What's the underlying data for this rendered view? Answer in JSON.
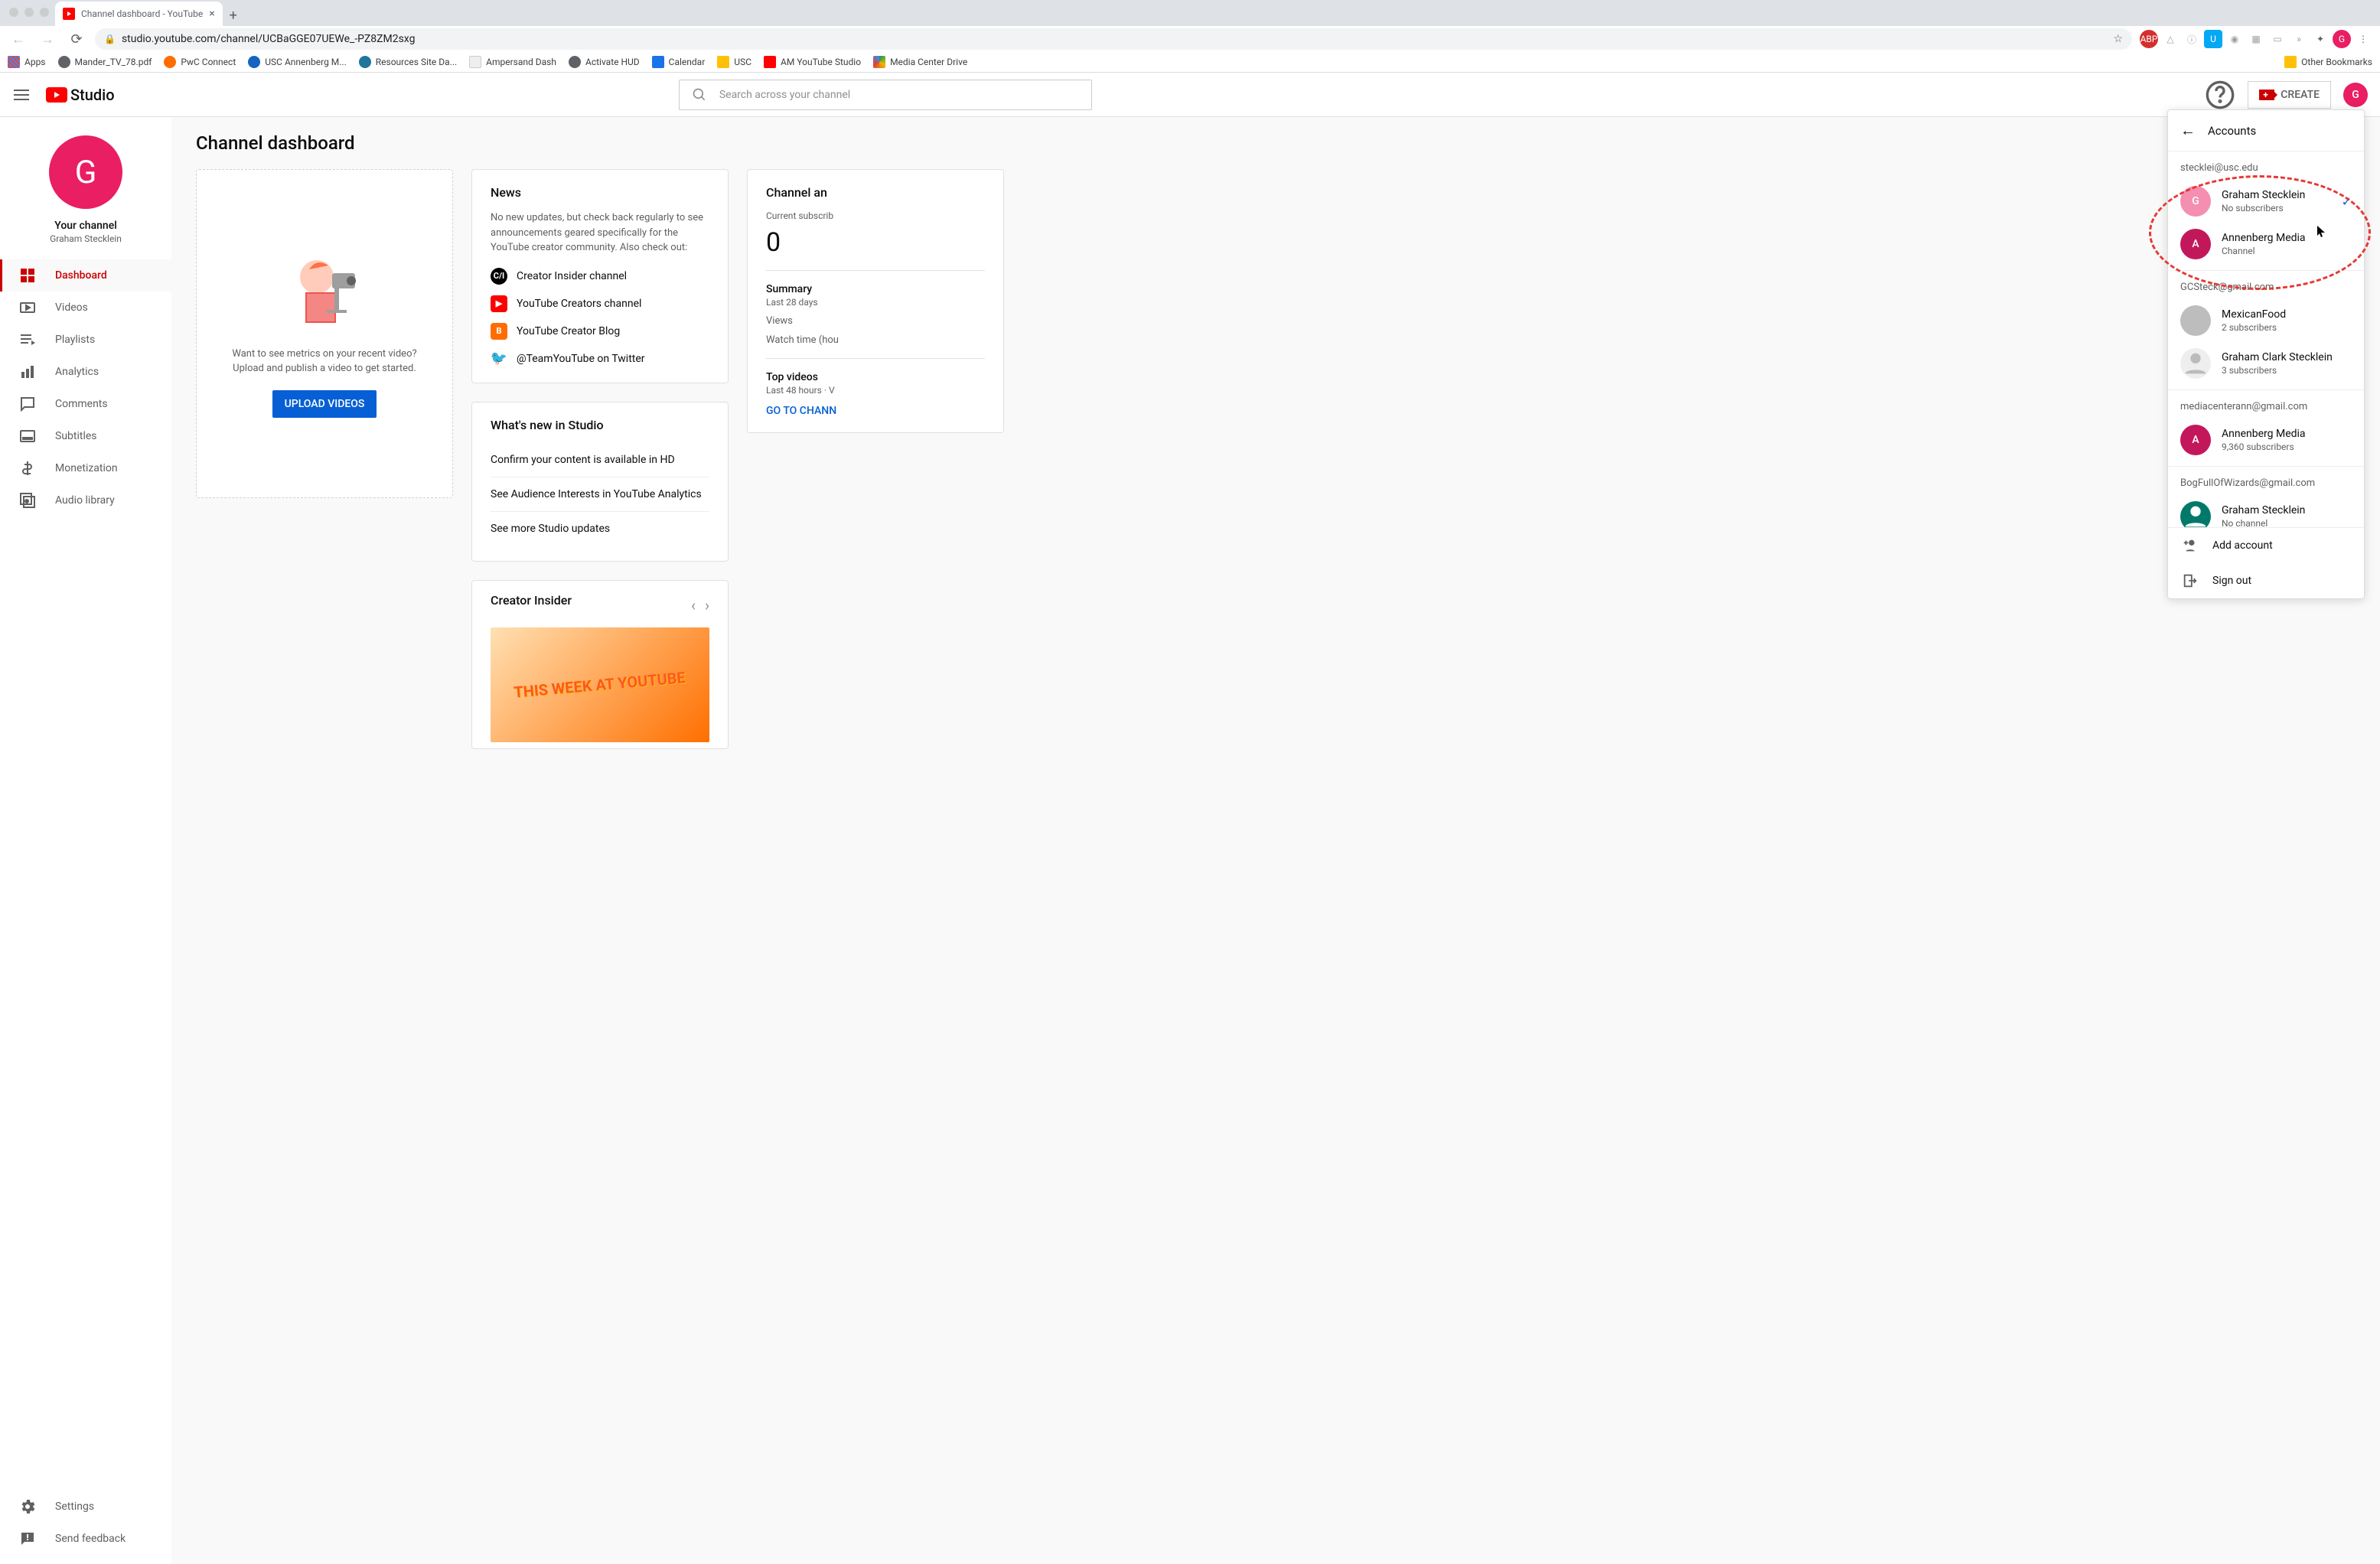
{
  "browser": {
    "tab_title": "Channel dashboard - YouTube",
    "url": "studio.youtube.com/channel/UCBaGGE07UEWe_-PZ8ZM2sxg",
    "bookmarks": [
      "Apps",
      "Mander_TV_78.pdf",
      "PwC Connect",
      "USC Annenberg M...",
      "Resources Site Da...",
      "Ampersand Dash",
      "Activate HUD",
      "Calendar",
      "USC",
      "AM YouTube Studio",
      "Media Center Drive"
    ],
    "other_bookmarks": "Other Bookmarks"
  },
  "header": {
    "logo_text": "Studio",
    "search_placeholder": "Search across your channel",
    "create_label": "CREATE",
    "avatar_letter": "G"
  },
  "sidebar": {
    "your_channel": "Your channel",
    "channel_name": "Graham Stecklein",
    "avatar_letter": "G",
    "items": [
      {
        "label": "Dashboard",
        "active": true
      },
      {
        "label": "Videos",
        "active": false
      },
      {
        "label": "Playlists",
        "active": false
      },
      {
        "label": "Analytics",
        "active": false
      },
      {
        "label": "Comments",
        "active": false
      },
      {
        "label": "Subtitles",
        "active": false
      },
      {
        "label": "Monetization",
        "active": false
      },
      {
        "label": "Audio library",
        "active": false
      }
    ],
    "footer": [
      {
        "label": "Settings"
      },
      {
        "label": "Send feedback"
      }
    ]
  },
  "main": {
    "title": "Channel dashboard",
    "empty": {
      "line1": "Want to see metrics on your recent video?",
      "line2": "Upload and publish a video to get started.",
      "button": "UPLOAD VIDEOS"
    },
    "news": {
      "title": "News",
      "body": "No new updates, but check back regularly to see announcements geared specifically for the YouTube creator community. Also check out:",
      "links": [
        {
          "label": "Creator Insider channel",
          "bg": "#000",
          "txt": "C/I"
        },
        {
          "label": "YouTube Creators channel",
          "bg": "#ff0000",
          "txt": "▶"
        },
        {
          "label": "YouTube Creator Blog",
          "bg": "#ff6d00",
          "txt": "B"
        },
        {
          "label": "@TeamYouTube on Twitter",
          "bg": "#1da1f2",
          "txt": "t"
        }
      ]
    },
    "whats_new": {
      "title": "What's new in Studio",
      "items": [
        "Confirm your content is available in HD",
        "See Audience Interests in YouTube Analytics",
        "See more Studio updates"
      ]
    },
    "creator": {
      "title": "Creator Insider",
      "thumb_text": "THIS WEEK AT YOUTUBE"
    },
    "analytics": {
      "title_partial": "Channel an",
      "subs_label": "Current subscrib",
      "subs_value": "0",
      "summary_title": "Summary",
      "summary_period": "Last 28 days",
      "views_label": "Views",
      "watch_label": "Watch time (hou",
      "top_title": "Top videos",
      "top_period_partial": "Last 48 hours · V",
      "cta_partial": "GO TO CHANN"
    }
  },
  "accounts": {
    "title": "Accounts",
    "groups": [
      {
        "email": "stecklei@usc.edu",
        "rows": [
          {
            "name": "Graham Stecklein",
            "meta": "No subscribers",
            "avatar_bg": "#e91e63",
            "avatar_txt": "G",
            "checked": true
          },
          {
            "name": "Annenberg Media",
            "meta": "Channel",
            "avatar_bg": "#c2185b",
            "avatar_txt": "A",
            "checked": false
          }
        ]
      },
      {
        "email": "GCSteck@gmail.com",
        "rows": [
          {
            "name": "MexicanFood",
            "meta": "2 subscribers",
            "avatar_bg": "#9e9e9e",
            "avatar_txt": "",
            "checked": false
          },
          {
            "name": "Graham Clark Stecklein",
            "meta": "3 subscribers",
            "avatar_bg": "#eeeeee",
            "avatar_txt": "",
            "checked": false
          }
        ]
      },
      {
        "email": "mediacenterann@gmail.com",
        "rows": [
          {
            "name": "Annenberg Media",
            "meta": "9,360 subscribers",
            "avatar_bg": "#c2185b",
            "avatar_txt": "A",
            "checked": false
          }
        ]
      },
      {
        "email": "BogFullOfWizards@gmail.com",
        "rows": [
          {
            "name": "Graham Stecklein",
            "meta": "No channel",
            "avatar_bg": "#00796b",
            "avatar_txt": "",
            "checked": false
          }
        ]
      }
    ],
    "add_account": "Add account",
    "sign_out": "Sign out"
  },
  "colors": {
    "accent": "#cc0000",
    "link": "#065fd4",
    "pink": "#e91e63"
  }
}
